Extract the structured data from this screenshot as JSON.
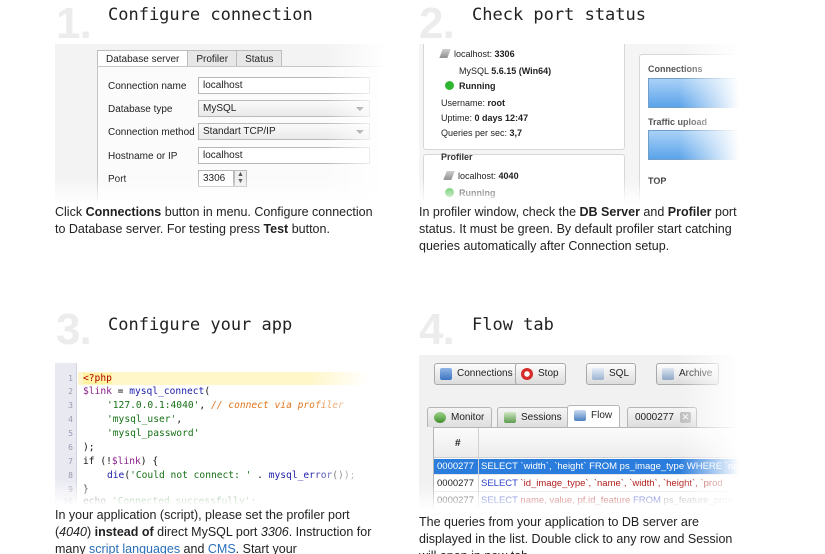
{
  "steps": [
    {
      "num": "1.",
      "title": "Configure connection",
      "tabs": [
        "Database server",
        "Profiler",
        "Status"
      ],
      "form": [
        {
          "label": "Connection name",
          "value": "localhost"
        },
        {
          "label": "Database type",
          "value": "MySQL"
        },
        {
          "label": "Connection method",
          "value": "Standart TCP/IP"
        },
        {
          "label": "Hostname or IP",
          "value": "localhost"
        },
        {
          "label": "Port",
          "value": "3306"
        }
      ],
      "caption": {
        "a": "Click ",
        "b": "Connections",
        "c": " button in menu. Configure connection to Database server. For testing press ",
        "d": "Test",
        "e": " button."
      }
    },
    {
      "num": "2.",
      "title": "Check port status",
      "server": {
        "host": "localhost:",
        "port": "3306",
        "mysql_label": "MySQL",
        "mysql_version": "5.6.15 (Win64)",
        "status": "Running",
        "username_label": "Username:",
        "username": "root",
        "uptime_label": "Uptime:",
        "uptime": "0 days 12:47",
        "qps_label": "Queries per sec:",
        "qps": "3,7"
      },
      "profiler": {
        "section": "Profiler",
        "host": "localhost:",
        "port": "4040",
        "status": "Running"
      },
      "graphs": {
        "connections": "Connections",
        "traffic": "Traffic upload",
        "top": "TOP"
      },
      "caption": {
        "a": "In profiler window, check the ",
        "b": "DB Server",
        "c": " and ",
        "d": "Profiler",
        "e": " port status. It must be green. By default profiler start catching queries automatically after Connection setup."
      }
    },
    {
      "num": "3.",
      "title": "Configure your app",
      "code": {
        "l1": "<?php",
        "l2_var": "$link",
        "l2_eq": " = ",
        "l2_fn": "mysql_connect",
        "l2_p": "(",
        "l3_str": "'127.0.0.1:4040'",
        "l3_c": ", ",
        "l3_cmt": "// connect via profiler",
        "l4_str": "'mysql_user'",
        "l4_c": ",",
        "l5_str": "'mysql_password'",
        "l6": ");",
        "l7_a": "if (!",
        "l7_var": "$link",
        "l7_b": ") {",
        "l8_fn": "die",
        "l8_a": "(",
        "l8_str": "'Could not connect: '",
        "l8_b": " . ",
        "l8_fn2": "mysql_error",
        "l8_c": "());",
        "l9": "}",
        "l10_a": "echo ",
        "l10_str": "'Connected successfully';",
        "line_numbers": [
          "1",
          "2",
          "3",
          "4",
          "5",
          "6",
          "7",
          "8",
          "9",
          "10"
        ]
      },
      "caption": {
        "a": "In your application (script), please set the profiler port (",
        "b": "4040",
        "c": ") ",
        "d": "instead of",
        "e": " direct MySQL port ",
        "f": "3306",
        "g": ". Instruction for many ",
        "link1": "script languages",
        "h": " and ",
        "link2": "CMS",
        "i": ". Start your"
      }
    },
    {
      "num": "4.",
      "title": "Flow tab",
      "toolbar": [
        "Connections",
        "Stop",
        "SQL",
        "Archive"
      ],
      "tabs": [
        "Monitor",
        "Sessions",
        "Flow",
        "0000277"
      ],
      "grid_header": "#",
      "rows": [
        {
          "id": "0000277",
          "k1": "SELECT",
          "f": " `width`, `height` ",
          "k2": "FROM",
          "t": " ps_image_type ",
          "k3": "WHERE",
          "r": " `na"
        },
        {
          "id": "0000277",
          "k1": "SELECT",
          "f": " `id_image_type`, `name`, `width`, `height`, `prod",
          "k2": "",
          "t": "",
          "k3": "",
          "r": ""
        },
        {
          "id": "0000277",
          "k1": "SELECT",
          "f": " name, value, pf.id_feature ",
          "k2": "FROM",
          "t": " ps_feature_prod",
          "k3": "",
          "r": ""
        }
      ],
      "caption": {
        "a": "The queries from your application to DB server are displayed in the list. Double click to any row and Session will open in new tab."
      }
    }
  ]
}
